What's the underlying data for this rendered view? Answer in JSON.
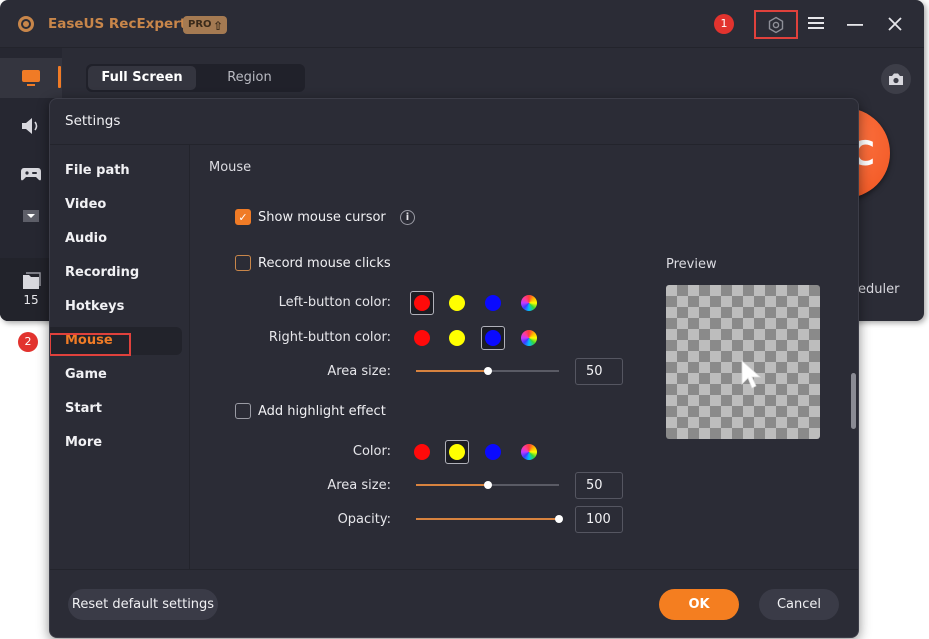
{
  "app": {
    "title": "EaseUS RecExperts",
    "pro_badge": "PRO",
    "annotation_1": "1",
    "annotation_2": "2",
    "mode_tabs": [
      {
        "label": "Full Screen",
        "active": true
      },
      {
        "label": "Region",
        "active": false
      }
    ],
    "recordings_count": "15",
    "record_button_label": "C",
    "scheduler_partial": "eduler"
  },
  "settings": {
    "title": "Settings",
    "nav": [
      {
        "label": "File path",
        "active": false
      },
      {
        "label": "Video",
        "active": false
      },
      {
        "label": "Audio",
        "active": false
      },
      {
        "label": "Recording",
        "active": false
      },
      {
        "label": "Hotkeys",
        "active": false
      },
      {
        "label": "Mouse",
        "active": true
      },
      {
        "label": "Game",
        "active": false
      },
      {
        "label": "Start",
        "active": false
      },
      {
        "label": "More",
        "active": false
      }
    ],
    "section_title": "Mouse",
    "show_cursor": {
      "label": "Show mouse cursor",
      "checked": true
    },
    "record_clicks": {
      "label": "Record mouse clicks",
      "checked": false
    },
    "left_button_color": {
      "label": "Left-button color:",
      "selected": "red"
    },
    "right_button_color": {
      "label": "Right-button color:",
      "selected": "blue"
    },
    "click_area_size": {
      "label": "Area size:",
      "value": "50",
      "fraction": 0.5
    },
    "highlight": {
      "label": "Add highlight effect",
      "checked": false
    },
    "highlight_color": {
      "label": "Color:",
      "selected": "yellow"
    },
    "highlight_area_size": {
      "label": "Area size:",
      "value": "50",
      "fraction": 0.5
    },
    "highlight_opacity": {
      "label": "Opacity:",
      "value": "100",
      "fraction": 1.0
    },
    "swatch_colors": {
      "red": "#ff0a0a",
      "yellow": "#ffff00",
      "blue": "#0a0aff",
      "custom": "rainbow"
    },
    "preview_label": "Preview",
    "buttons": {
      "reset": "Reset default settings",
      "ok": "OK",
      "cancel": "Cancel"
    }
  },
  "colors": {
    "accent": "#f07b26",
    "annotation": "#e0413c",
    "background": "#2b2c36"
  }
}
